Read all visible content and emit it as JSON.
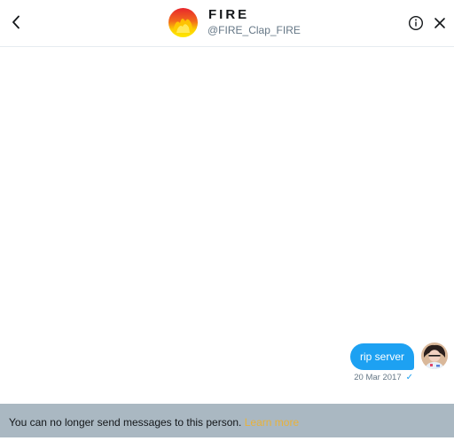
{
  "header": {
    "display_name": "FIRE",
    "handle": "@FIRE_Clap_FIRE",
    "back_icon": "chevron-left-icon",
    "info_icon": "info-icon",
    "close_icon": "close-icon"
  },
  "conversation": {
    "messages": [
      {
        "text": "rip server",
        "timestamp": "20 Mar 2017",
        "status_icon": "checkmark-icon",
        "status_glyph": "✓",
        "direction": "sent"
      }
    ]
  },
  "footer": {
    "notice": "You can no longer send messages to this person.",
    "learn_more": "Learn more"
  },
  "colors": {
    "accent": "#1da1f2",
    "footer_bg": "#aab8c2",
    "link": "#e8b23a"
  }
}
